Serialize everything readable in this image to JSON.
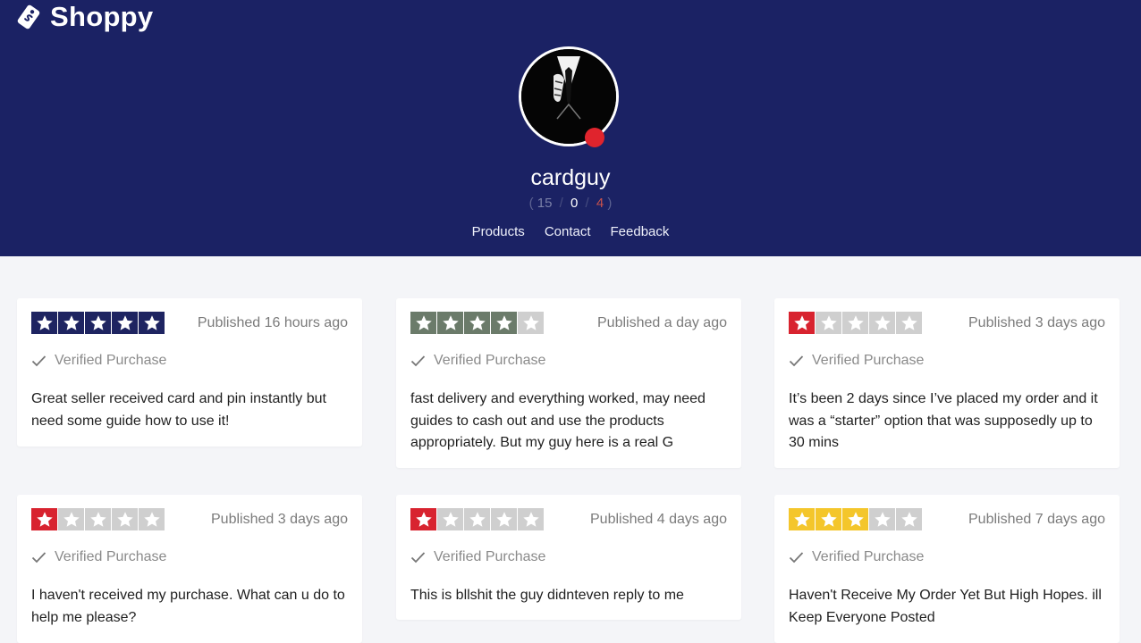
{
  "brand": {
    "name": "Shoppy",
    "logo_icon": "tag-icon"
  },
  "seller": {
    "username": "cardguy",
    "status_color": "#e0242d",
    "feedback": {
      "positive": "15",
      "neutral": "0",
      "negative": "4",
      "separator": "/",
      "open": "(",
      "close": ")"
    }
  },
  "nav": {
    "products": "Products",
    "contact": "Contact",
    "feedback": "Feedback"
  },
  "reviews": [
    {
      "rating": 5,
      "star_color": "#1e2461",
      "published": "Published 16 hours ago",
      "verified": "Verified Purchase",
      "text": "Great seller received card and pin instantly but need some guide how to use it!"
    },
    {
      "rating": 4,
      "star_color": "#6b7b6a",
      "published": "Published a day ago",
      "verified": "Verified Purchase",
      "text": "fast delivery and everything worked, may need guides to cash out and use the products appropriately. But my guy here is a real G"
    },
    {
      "rating": 1,
      "star_color": "#d8232f",
      "published": "Published 3 days ago",
      "verified": "Verified Purchase",
      "text": "It’s been 2 days since I’ve placed my order and it was a “starter” option that was supposedly up to 30 mins"
    },
    {
      "rating": 1,
      "star_color": "#d8232f",
      "published": "Published 3 days ago",
      "verified": "Verified Purchase",
      "text": "I haven't received my purchase. What can u do to help me please?"
    },
    {
      "rating": 1,
      "star_color": "#d8232f",
      "published": "Published 4 days ago",
      "verified": "Verified Purchase",
      "text": "This is bllshit the guy didnteven reply to me"
    },
    {
      "rating": 3,
      "star_color": "#f4c62b",
      "published": "Published 7 days ago",
      "verified": "Verified Purchase",
      "text": "Haven't Receive My Order Yet But High Hopes. ill Keep Everyone Posted"
    }
  ],
  "colors": {
    "header_bg": "#1b2264",
    "page_bg": "#f4f5f8",
    "empty_star": "#cfcfcf"
  },
  "icons": {
    "star": "star-icon",
    "check": "check-icon",
    "avatar": "avatar-image"
  }
}
